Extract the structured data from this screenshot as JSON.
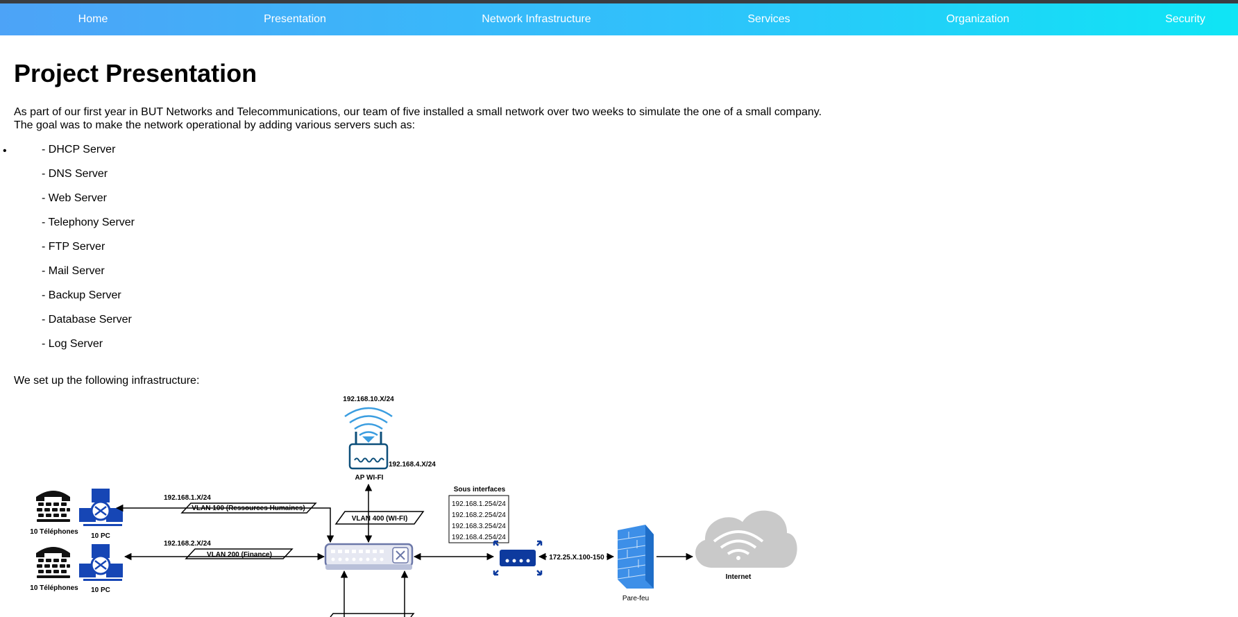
{
  "nav": {
    "home": "Home",
    "presentation": "Presentation",
    "network": "Network Infrastructure",
    "services": "Services",
    "organization": "Organization",
    "security": "Security"
  },
  "page": {
    "title": "Project Presentation",
    "intro_line1": "As part of our first year in BUT Networks and Telecommunications, our team of five installed a small network over two weeks to simulate the one of a small company.",
    "intro_line2": "The goal was to make the network operational by adding various servers such as:",
    "services": [
      "- DHCP Server",
      "- DNS Server",
      "- Web Server",
      "- Telephony Server",
      "- FTP Server",
      "- Mail Server",
      "- Backup Server",
      "- Database Server",
      "- Log Server"
    ],
    "infra_intro": "We set up the following infrastructure:"
  },
  "diagram": {
    "ap_subnet": "192.168.10.X/24",
    "ap_ip": "192.168.4.X/24",
    "ap_label": "AP WI-FI",
    "vlan100_subnet": "192.168.1.X/24",
    "vlan100_label": "VLAN 100 (Ressources Humaines)",
    "vlan200_subnet": "192.168.2.X/24",
    "vlan200_label": "VLAN 200 (Finance)",
    "vlan400_label": "VLAN 400 (WI-FI)",
    "phones_label_1": "10 Téléphones",
    "pcs_label_1": "10 PC",
    "phones_label_2": "10 Téléphones",
    "pcs_label_2": "10 PC",
    "subif_title": "Sous interfaces",
    "subif_1": "192.168.1.254/24",
    "subif_2": "192.168.2.254/24",
    "subif_3": "192.168.3.254/24",
    "subif_4": "192.168.4.254/24",
    "wan_link": "172.25.X.100-150",
    "firewall_label": "Pare-feu",
    "internet_label": "Internet",
    "colors": {
      "device": "#0d3a9e",
      "pc": "#1646b5",
      "firewall": "#3d8fe8",
      "cloud": "#c9c9c9",
      "wifi": "#3a9de0"
    }
  }
}
